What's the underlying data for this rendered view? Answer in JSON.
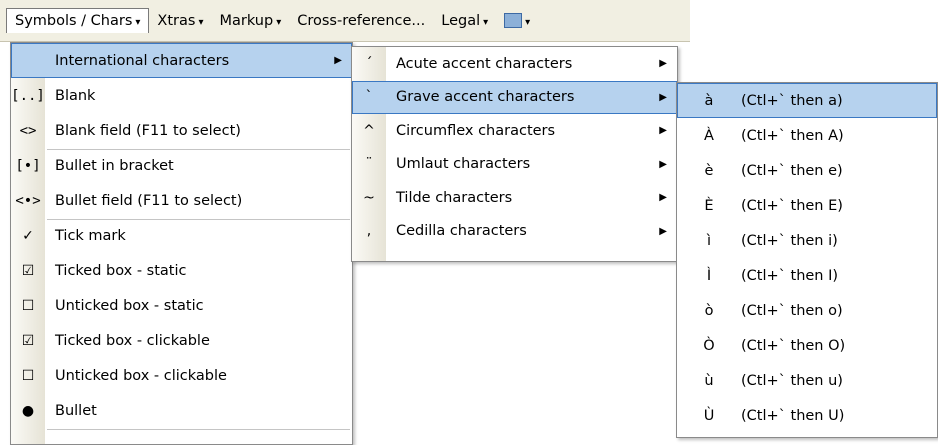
{
  "menubar": {
    "items": [
      {
        "label": "Symbols / Chars",
        "active": true
      },
      {
        "label": "Xtras"
      },
      {
        "label": "Markup"
      },
      {
        "label": "Cross-reference..."
      },
      {
        "label": "Legal"
      }
    ]
  },
  "menu1": {
    "items": [
      {
        "label": "International characters",
        "icon": "",
        "submenu": true
      },
      {
        "label": "Blank",
        "icon": "[..]"
      },
      {
        "label": "Blank field   (F11 to select)",
        "icon": "<>"
      },
      {
        "label": "Bullet in bracket",
        "icon": "[•]"
      },
      {
        "label": "Bullet field   (F11 to select)",
        "icon": "<•>"
      },
      {
        "label": "Tick mark",
        "icon": "✓"
      },
      {
        "label": "Ticked box - static",
        "icon": "☑"
      },
      {
        "label": "Unticked box - static",
        "icon": "☐"
      },
      {
        "label": "Ticked box - clickable",
        "icon": "☑"
      },
      {
        "label": "Unticked box - clickable",
        "icon": "☐"
      },
      {
        "label": "Bullet",
        "icon": "●"
      }
    ]
  },
  "menu2": {
    "items": [
      {
        "icon": "´",
        "label": "Acute accent characters"
      },
      {
        "icon": "`",
        "label": "Grave accent characters"
      },
      {
        "icon": "^",
        "label": "Circumflex characters"
      },
      {
        "icon": "¨",
        "label": "Umlaut characters"
      },
      {
        "icon": "~",
        "label": "Tilde characters"
      },
      {
        "icon": ",",
        "label": "Cedilla characters"
      }
    ]
  },
  "menu3": {
    "items": [
      {
        "char": "à",
        "shortcut": "(Ctl+` then a)"
      },
      {
        "char": "À",
        "shortcut": "(Ctl+` then A)"
      },
      {
        "char": "è",
        "shortcut": "(Ctl+` then e)"
      },
      {
        "char": "È",
        "shortcut": "(Ctl+` then E)"
      },
      {
        "char": "ì",
        "shortcut": "(Ctl+` then i)"
      },
      {
        "char": "Ì",
        "shortcut": "(Ctl+` then I)"
      },
      {
        "char": "ò",
        "shortcut": "(Ctl+` then o)"
      },
      {
        "char": "Ò",
        "shortcut": "(Ctl+` then O)"
      },
      {
        "char": "ù",
        "shortcut": "(Ctl+` then u)"
      },
      {
        "char": "Ù",
        "shortcut": "(Ctl+` then U)"
      }
    ]
  }
}
